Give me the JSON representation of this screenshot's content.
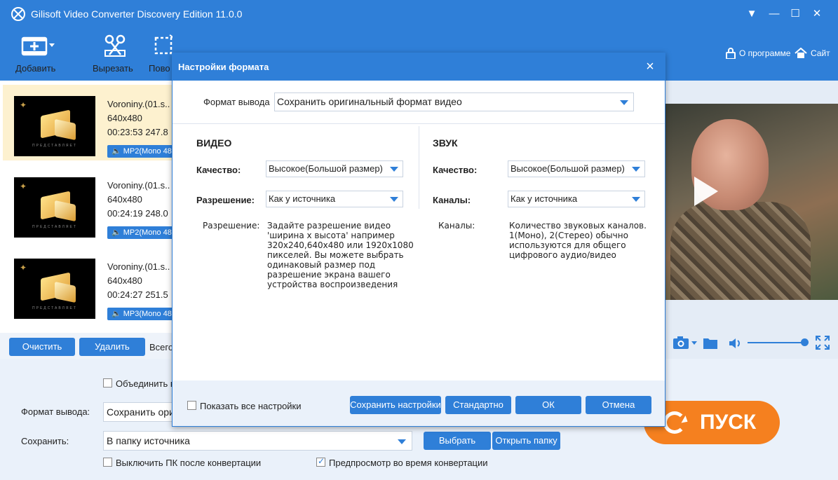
{
  "app": {
    "title": "Gilisoft Video Converter Discovery Edition 11.0.0"
  },
  "toolbar": {
    "add": "Добавить",
    "cut": "Вырезать",
    "rotate": "Пово",
    "about": "О программе",
    "site": "Сайт"
  },
  "files": [
    {
      "name": "Voroniny.(01.s..",
      "res": "640x480",
      "dur": "00:23:53  247.8",
      "badge": "MP2(Mono 48"
    },
    {
      "name": "Voroniny.(01.s..",
      "res": "640x480",
      "dur": "00:24:19  248.0",
      "badge": "MP2(Mono 48"
    },
    {
      "name": "Voroniny.(01.s..",
      "res": "640x480",
      "dur": "00:24:27  251.5",
      "badge": "MP3(Mono 48"
    }
  ],
  "thumb_caption": "ПРЕДСТАВЛЯЕТ",
  "list_buttons": {
    "clear": "Очистить",
    "delete": "Удалить",
    "total": "Всего"
  },
  "bottom": {
    "merge_label": "Объединить в",
    "format_label": "Формат вывода:",
    "format_value": "Сохранить ори",
    "save_label": "Сохранить:",
    "save_value": "В папку источника",
    "choose": "Выбрать",
    "open_folder": "Открыть папку",
    "shutdown": "Выключить ПК после конвертации",
    "preview": "Предпросмотр во время конвертации",
    "start": "ПУСК"
  },
  "modal": {
    "title": "Настройки формата",
    "output_label": "Формат вывода",
    "output_value": "Сохранить оригинальный формат видео",
    "video": {
      "title": "ВИДЕО",
      "quality_label": "Качество:",
      "quality_value": "Высокое(Большой размер)",
      "res_label": "Разрешение:",
      "res_value": "Как у источника",
      "help_label": "Разрешение:",
      "help_lines": [
        "Задайте разрешение видео",
        "'ширина x высота' например",
        "320x240,640x480 или 1920x1080",
        "пикселей. Вы можете выбрать",
        "одинаковый размер под",
        "разрешение экрана вашего",
        "устройства воспроизведения"
      ]
    },
    "audio": {
      "title": "ЗВУК",
      "quality_label": "Качество:",
      "quality_value": "Высокое(Большой размер)",
      "channels_label": "Каналы:",
      "channels_value": "Как у источника",
      "help_label": "Каналы:",
      "help_lines": [
        "Количество звуковых каналов.",
        "1(Моно), 2(Стерео) обычно",
        "используются для общего",
        "цифрового аудио/видео"
      ]
    },
    "show_all": "Показать все настройки",
    "buttons": {
      "save": "Сохранить настройки",
      "default": "Стандартно",
      "ok": "ОК",
      "cancel": "Отмена"
    }
  },
  "colors": {
    "accent": "#2f7fd8",
    "start": "#f5801f",
    "selected_row": "#fdf1cf"
  }
}
